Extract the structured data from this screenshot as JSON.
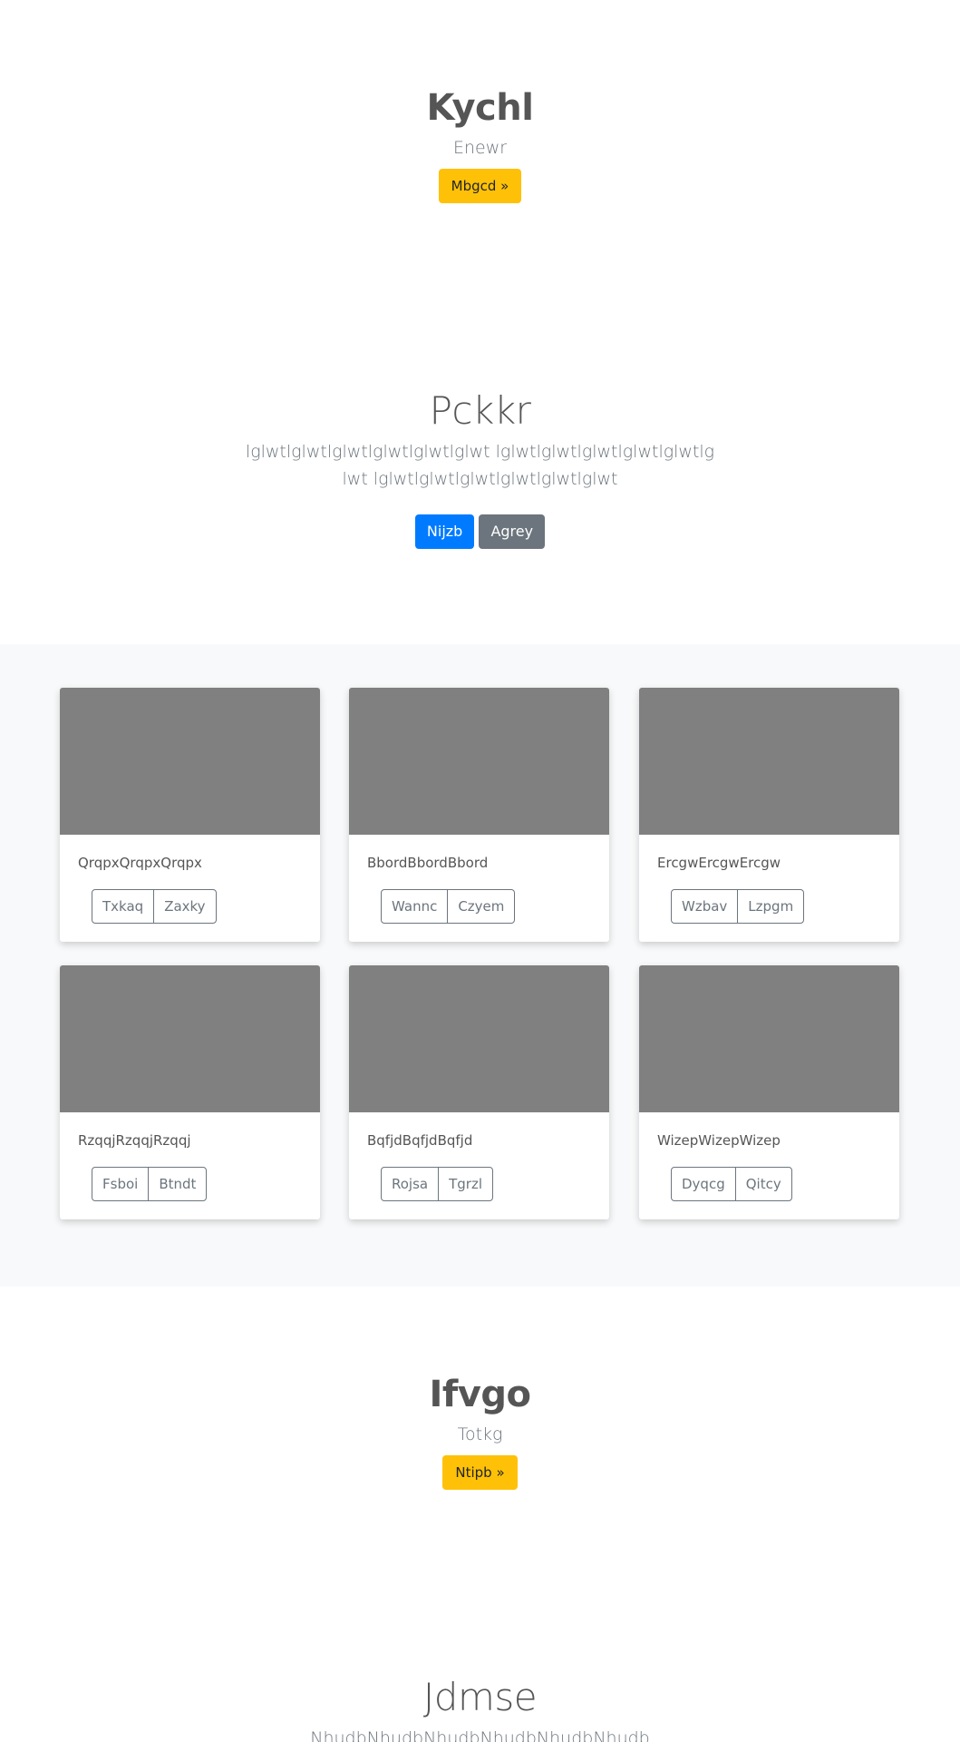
{
  "hero1": {
    "title": "Kychl",
    "subtitle": "Enewr",
    "button": "Mbgcd »"
  },
  "jumbotron": {
    "title": "Pckkr",
    "lead": "lglwtlglwtlglwtlglwtlglwtlglwt lglwtlglwtlglwtlglwtlglwtlglwt lglwtlglwtlglwtlglwtlglwtlglwt",
    "primary_button": "Nijzb",
    "secondary_button": "Agrey"
  },
  "cards": [
    {
      "text": "QrqpxQrqpxQrqpx",
      "buttons": [
        "Txkaq",
        "Zaxky"
      ]
    },
    {
      "text": "BbordBbordBbord",
      "buttons": [
        "Wannc",
        "Czyem"
      ]
    },
    {
      "text": "ErcgwErcgwErcgw",
      "buttons": [
        "Wzbav",
        "Lzpgm"
      ]
    },
    {
      "text": "RzqqjRzqqjRzqqj",
      "buttons": [
        "Fsboi",
        "Btndt"
      ]
    },
    {
      "text": "BqfjdBqfjdBqfjd",
      "buttons": [
        "Rojsa",
        "Tgrzl"
      ]
    },
    {
      "text": "WizepWizepWizep",
      "buttons": [
        "Dyqcg",
        "Qitcy"
      ]
    }
  ],
  "hero2": {
    "title": "Ifvgo",
    "subtitle": "Totkg",
    "button": "Ntipb »"
  },
  "jumbotron2": {
    "title": "Jdmse",
    "lead": "NhudbNhudbNhudbNhudbNhudbNhudb"
  },
  "colors": {
    "warning": "#ffc107",
    "primary": "#007bff",
    "secondary": "#6c757d",
    "placeholder": "#808080",
    "album_bg": "#f8f9fa"
  }
}
